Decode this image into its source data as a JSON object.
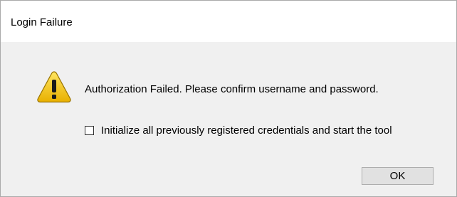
{
  "dialog": {
    "title": "Login Failure",
    "icon": "warning-icon",
    "message": "Authorization Failed. Please confirm username and password.",
    "checkbox": {
      "label": "Initialize all previously registered credentials and start the tool",
      "checked": false
    },
    "ok_label": "OK"
  },
  "colors": {
    "titlebar_bg": "#ffffff",
    "body_bg": "#f0f0f0",
    "button_bg": "#e1e1e1",
    "warning_yellow": "#f5c400"
  }
}
